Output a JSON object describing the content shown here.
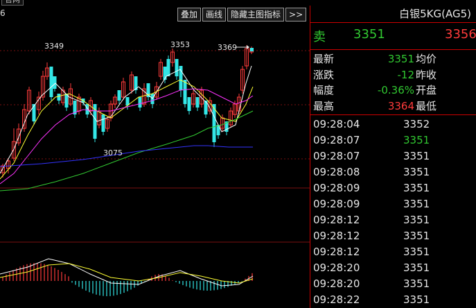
{
  "window": {
    "tab_fragment": "官网",
    "left_fragment": "6"
  },
  "toolbar": {
    "overlay": "叠加",
    "draw_line": "画线",
    "hide_main_indicator": "隐藏主图指标",
    "more": ">>"
  },
  "chart_data": {
    "type": "candlestick",
    "price_labels": [
      {
        "text": "3349",
        "value": 3349
      },
      {
        "text": "3353",
        "value": 3353
      },
      {
        "text": "3369",
        "value": 3369
      },
      {
        "text": "3075",
        "value": 3075
      }
    ],
    "colors": {
      "up": "#ff3b3b",
      "down": "#33e6e6",
      "ma5": "#ffffff",
      "ma10": "#ffff33",
      "ma20": "#ff33ff",
      "ma60": "#33cc33",
      "ma120": "#3333ff"
    }
  },
  "panel": {
    "title": "白银5KG(AG5)",
    "side_label": "卖",
    "bid": "3351",
    "ask": "3356",
    "stats": [
      {
        "label": "最新",
        "value": "3351",
        "color": "green",
        "label2": "均价"
      },
      {
        "label": "涨跌",
        "value": "-12",
        "color": "green",
        "label2": "昨收"
      },
      {
        "label": "幅度",
        "value": "-0.36%",
        "color": "green",
        "label2": "开盘"
      },
      {
        "label": "最高",
        "value": "3364",
        "color": "red",
        "label2": "最低"
      }
    ],
    "ticks": [
      {
        "time": "09:28:04",
        "price": "3352",
        "color": "white"
      },
      {
        "time": "09:28:07",
        "price": "3351",
        "color": "green"
      },
      {
        "time": "09:28:07",
        "price": "3351",
        "color": "white"
      },
      {
        "time": "09:28:08",
        "price": "3351",
        "color": "white"
      },
      {
        "time": "09:28:09",
        "price": "3351",
        "color": "white"
      },
      {
        "time": "09:28:09",
        "price": "3351",
        "color": "white"
      },
      {
        "time": "09:28:12",
        "price": "3351",
        "color": "white"
      },
      {
        "time": "09:28:12",
        "price": "3351",
        "color": "white"
      },
      {
        "time": "09:28:12",
        "price": "3351",
        "color": "white"
      },
      {
        "time": "09:28:20",
        "price": "3351",
        "color": "white"
      },
      {
        "time": "09:28:20",
        "price": "3351",
        "color": "white"
      },
      {
        "time": "09:28:22",
        "price": "3351",
        "color": "white"
      }
    ]
  }
}
